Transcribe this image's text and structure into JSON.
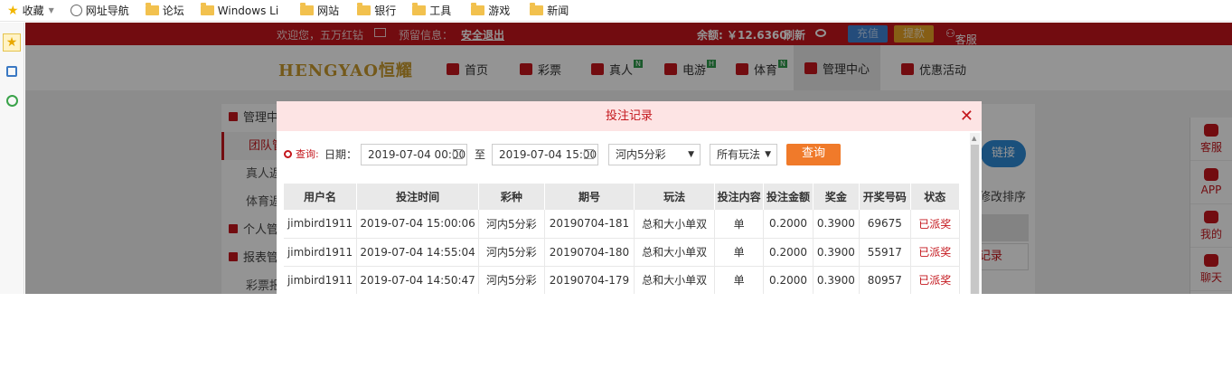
{
  "bookmarks": [
    {
      "label": "收藏",
      "icon": "star-icon"
    },
    {
      "label": "网址导航",
      "icon": "globe-icon"
    },
    {
      "label": "论坛",
      "icon": "folder-icon"
    },
    {
      "label": "Windows Li",
      "icon": "folder-icon"
    },
    {
      "label": "网站",
      "icon": "folder-icon"
    },
    {
      "label": "银行",
      "icon": "folder-icon"
    },
    {
      "label": "工具",
      "icon": "folder-icon"
    },
    {
      "label": "游戏",
      "icon": "folder-icon"
    },
    {
      "label": "新闻",
      "icon": "folder-icon"
    }
  ],
  "topbar": {
    "welcome": "欢迎您，五万红钻",
    "warning": "预留信息：",
    "logout": "安全退出",
    "balance": "余额: ￥12.6360",
    "refresh": "刷新",
    "recharge": "充值",
    "withdraw": "提款",
    "service": "客服"
  },
  "logo": "HENGYAO恒耀",
  "nav": {
    "home": "首页",
    "lottery": "彩票",
    "live": "真人",
    "egame": "电游",
    "sports": "体育",
    "manage": "管理中心",
    "promo": "优惠活动",
    "badge": "N",
    "badge_h": "H"
  },
  "leftmenu": {
    "m1": "管理中",
    "m2": "团队管",
    "m3": "真人返",
    "m4": "体育返",
    "m5": "个人管",
    "m6": "报表管",
    "m7": "彩票报"
  },
  "right": {
    "link": "链接",
    "sort": "修改排序",
    "record": "记录"
  },
  "dock": {
    "service": "客服",
    "app": "APP",
    "mine": "我的",
    "chat": "聊天"
  },
  "modal": {
    "title": "投注记录",
    "query_label": "查询:",
    "date_label": "日期：",
    "date_from": "2019-07-04 00:00:00",
    "to_label": "至",
    "date_to": "2019-07-04 15:00:00",
    "lottery_select": "河内5分彩",
    "play_select": "所有玩法",
    "search_button": "查询"
  },
  "columns": [
    "用户名",
    "投注时间",
    "彩种",
    "期号",
    "玩法",
    "投注内容",
    "投注金额",
    "奖金",
    "开奖号码",
    "状态"
  ],
  "rows": [
    [
      "jimbird1911",
      "2019-07-04 15:00:06",
      "河内5分彩",
      "20190704-181",
      "总和大小单双",
      "单",
      "0.2000",
      "0.3900",
      "69675",
      "已派奖"
    ],
    [
      "jimbird1911",
      "2019-07-04 14:55:04",
      "河内5分彩",
      "20190704-180",
      "总和大小单双",
      "单",
      "0.2000",
      "0.3900",
      "55917",
      "已派奖"
    ],
    [
      "jimbird1911",
      "2019-07-04 14:50:47",
      "河内5分彩",
      "20190704-179",
      "总和大小单双",
      "单",
      "0.2000",
      "0.3900",
      "80957",
      "已派奖"
    ]
  ],
  "colors": {
    "brand": "#c4161c",
    "accent": "#f07a2a",
    "modal_header": "#fde4e4"
  }
}
